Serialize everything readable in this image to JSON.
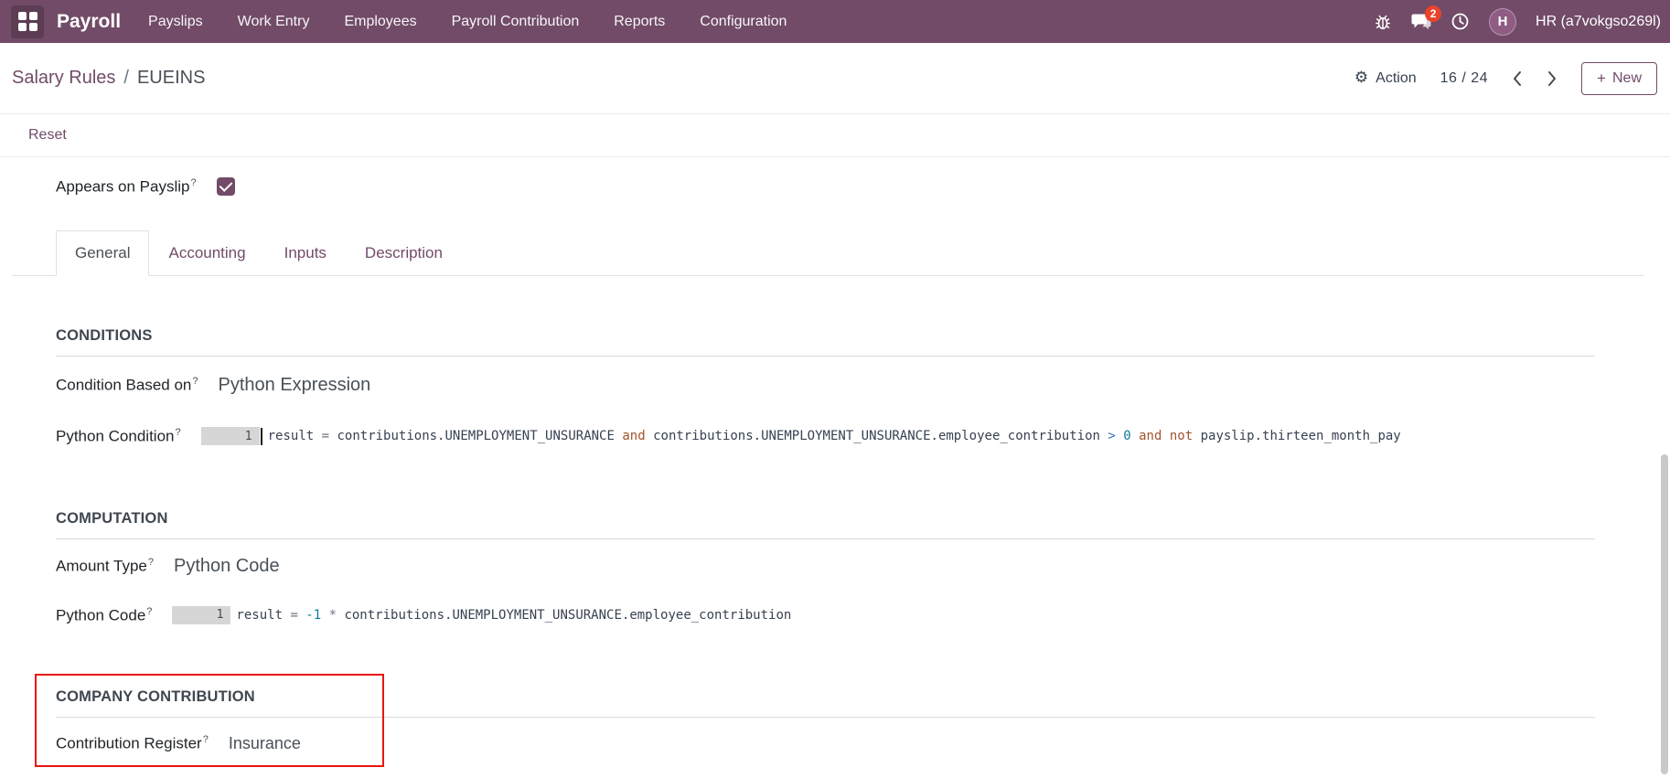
{
  "colors": {
    "navbar": "#714B67",
    "accent": "#714B67",
    "annotation_red": "#e8150f",
    "badge": "#e8432d"
  },
  "nav": {
    "app_name": "Payroll",
    "items": [
      "Payslips",
      "Work Entry",
      "Employees",
      "Payroll Contribution",
      "Reports",
      "Configuration"
    ],
    "message_badge": "2",
    "user_name": "HR (a7vokgso269l)",
    "avatar_initial": "H"
  },
  "breadcrumb": {
    "parent": "Salary Rules",
    "separator": "/",
    "current": "EUEINS"
  },
  "controls": {
    "gear": "⚙",
    "action_label": "Action",
    "pager": "16 / 24",
    "plus": "+",
    "new_label": "New"
  },
  "statusbar": {
    "reset_label": "Reset"
  },
  "form": {
    "help_marker": "?",
    "appears_on_payslip": {
      "label": "Appears on Payslip",
      "checked": true
    },
    "tabs": [
      {
        "label": "General",
        "active": true
      },
      {
        "label": "Accounting",
        "active": false
      },
      {
        "label": "Inputs",
        "active": false
      },
      {
        "label": "Description",
        "active": false
      }
    ],
    "conditions": {
      "title": "CONDITIONS",
      "condition_based_on": {
        "label": "Condition Based on",
        "value": "Python Expression"
      },
      "python_condition": {
        "label": "Python Condition",
        "line_number": "1",
        "code": [
          {
            "t": "result ",
            "c": "v"
          },
          {
            "t": "= ",
            "c": "o2"
          },
          {
            "t": "contributions.UNEMPLOYMENT_UNSURANCE ",
            "c": "v"
          },
          {
            "t": "and",
            "c": "k"
          },
          {
            "t": " contributions.UNEMPLOYMENT_UNSURANCE.employee_contribution ",
            "c": "v"
          },
          {
            "t": "> ",
            "c": "o"
          },
          {
            "t": "0",
            "c": "n"
          },
          {
            "t": " ",
            "c": "v"
          },
          {
            "t": "and",
            "c": "k"
          },
          {
            "t": " ",
            "c": "v"
          },
          {
            "t": "not",
            "c": "k"
          },
          {
            "t": " payslip.thirteen_month_pay",
            "c": "v"
          }
        ]
      }
    },
    "computation": {
      "title": "COMPUTATION",
      "amount_type": {
        "label": "Amount Type",
        "value": "Python Code"
      },
      "python_code": {
        "label": "Python Code",
        "line_number": "1",
        "code": [
          {
            "t": "result ",
            "c": "v"
          },
          {
            "t": "= ",
            "c": "o2"
          },
          {
            "t": "-1",
            "c": "n"
          },
          {
            "t": " ",
            "c": "v"
          },
          {
            "t": "* ",
            "c": "o2"
          },
          {
            "t": "contributions.UNEMPLOYMENT_UNSURANCE.employee_contribution",
            "c": "v"
          }
        ]
      }
    },
    "company_contribution": {
      "title": "COMPANY CONTRIBUTION",
      "contribution_register": {
        "label": "Contribution Register",
        "value": "Insurance"
      }
    }
  }
}
